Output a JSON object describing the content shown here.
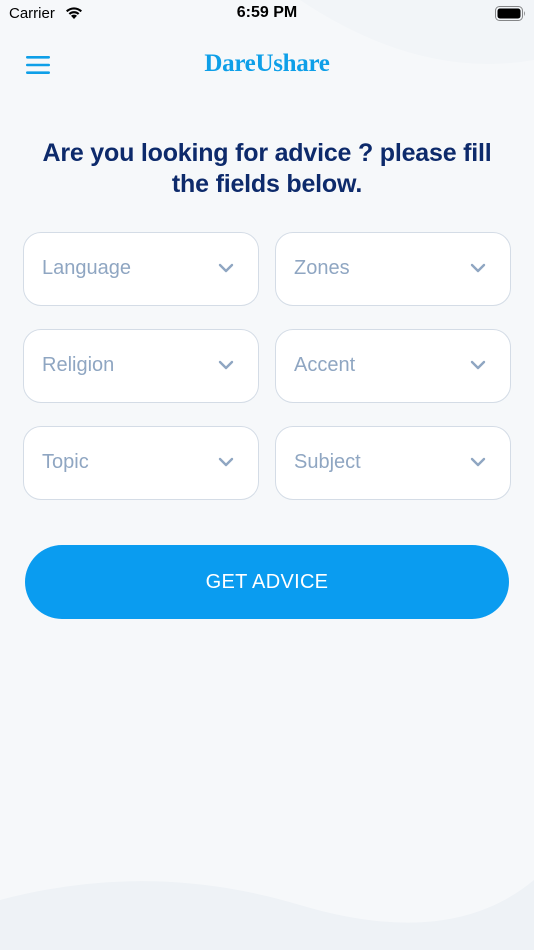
{
  "status_bar": {
    "carrier": "Carrier",
    "time": "6:59 PM",
    "wifi_icon": "wifi-icon",
    "battery_icon": "battery-icon"
  },
  "header": {
    "menu_icon": "hamburger-menu-icon",
    "brand": "DareUshare",
    "brand_color": "#0e9fe8"
  },
  "headline": "Are you looking for advice ? please fill the fields below.",
  "fields": [
    {
      "placeholder": "Language"
    },
    {
      "placeholder": "Zones"
    },
    {
      "placeholder": "Religion"
    },
    {
      "placeholder": "Accent"
    },
    {
      "placeholder": "Topic"
    },
    {
      "placeholder": "Subject"
    }
  ],
  "field_icon": "chevron-down-icon",
  "get_advice_label": "GET ADVICE",
  "colors": {
    "accent": "#0a9cf0",
    "headline": "#0d2a6b",
    "placeholder": "#8fa6c2"
  }
}
